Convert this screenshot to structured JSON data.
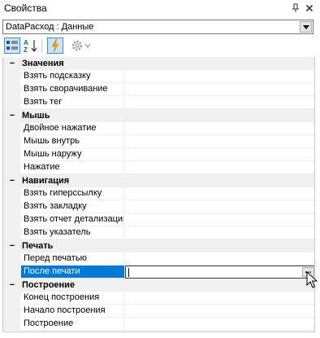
{
  "window": {
    "title": "Свойства",
    "pin_icon": "pin-icon",
    "close_icon": "close-icon"
  },
  "object_selector": {
    "value": "DataРасход : Данные"
  },
  "toolbar": {
    "categorized_icon": "categorized-icon",
    "alphabetical_icon": "sort-alphabetical-icon",
    "events_icon": "events-lightning-icon",
    "properties_icon": "gear-icon"
  },
  "grid": {
    "categories": [
      {
        "name": "Значения",
        "toggle": "−",
        "properties": [
          "Взять подсказку",
          "Взять сворачивание",
          "Взять тег"
        ]
      },
      {
        "name": "Мышь",
        "toggle": "−",
        "properties": [
          "Двойное нажатие",
          "Мышь внутрь",
          "Мышь наружу",
          "Нажатие"
        ]
      },
      {
        "name": "Навигация",
        "toggle": "−",
        "properties": [
          "Взять гиперссылку",
          "Взять закладку",
          "Взять отчет детализации",
          "Взять указатель"
        ]
      },
      {
        "name": "Печать",
        "toggle": "−",
        "properties": [
          "Перед печатью",
          "После печати"
        ]
      },
      {
        "name": "Построение",
        "toggle": "−",
        "properties": [
          "Конец построения",
          "Начало построения",
          "Построение"
        ]
      }
    ],
    "ellipsis_label": "..."
  }
}
